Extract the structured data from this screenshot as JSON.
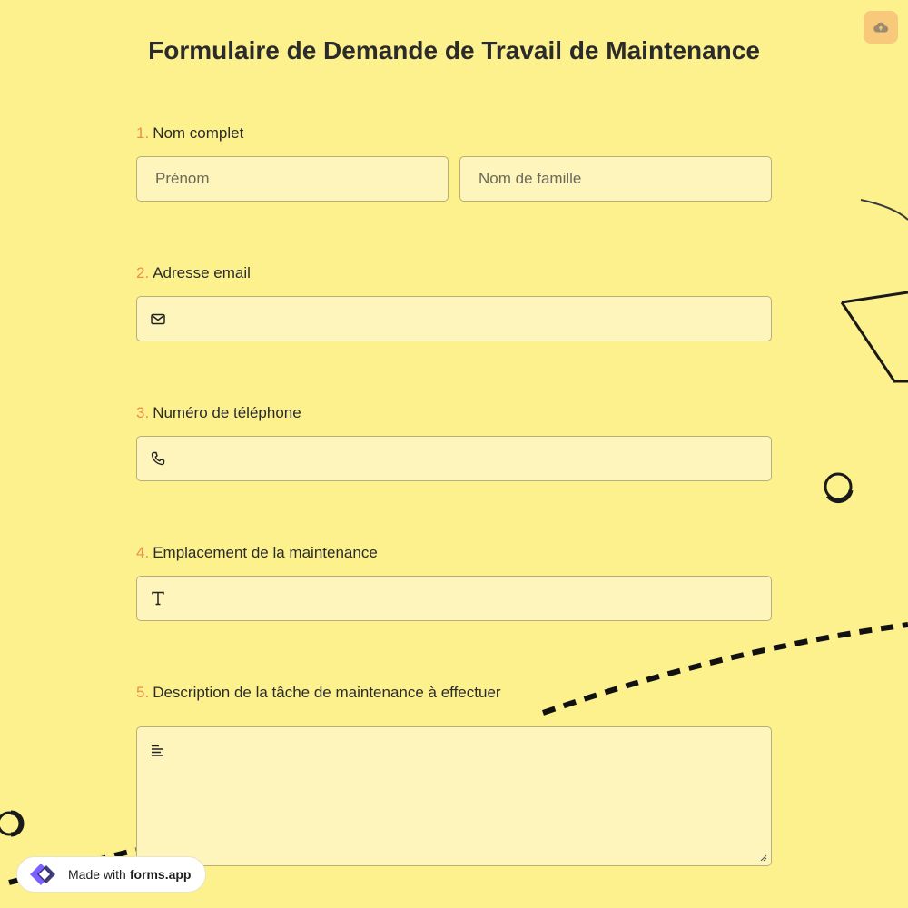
{
  "form": {
    "title": "Formulaire de Demande de Travail de Maintenance"
  },
  "questions": [
    {
      "number": "1.",
      "label": "Nom complet",
      "first_name_placeholder": "Prénom",
      "last_name_placeholder": "Nom de famille"
    },
    {
      "number": "2.",
      "label": "Adresse email",
      "icon": "envelope-icon",
      "value": ""
    },
    {
      "number": "3.",
      "label": "Numéro de téléphone",
      "icon": "phone-icon",
      "value": ""
    },
    {
      "number": "4.",
      "label": "Emplacement de la maintenance",
      "icon": "text-icon",
      "value": ""
    },
    {
      "number": "5.",
      "label": "Description de la tâche de maintenance à effectuer",
      "icon": "paragraph-icon",
      "value": ""
    }
  ],
  "toolbar": {
    "save_icon": "cloud-upload-icon"
  },
  "footer": {
    "made_with_prefix": "Made with",
    "brand": "forms.app",
    "logo_icon": "forms-app-logo-icon"
  },
  "colors": {
    "background": "#fdf18e",
    "field_background": "#fdf5bb",
    "field_border": "#b9ae79",
    "question_number": "#e8934a",
    "save_button": "#f8c97a",
    "logo_accent": "#7b61ff"
  }
}
